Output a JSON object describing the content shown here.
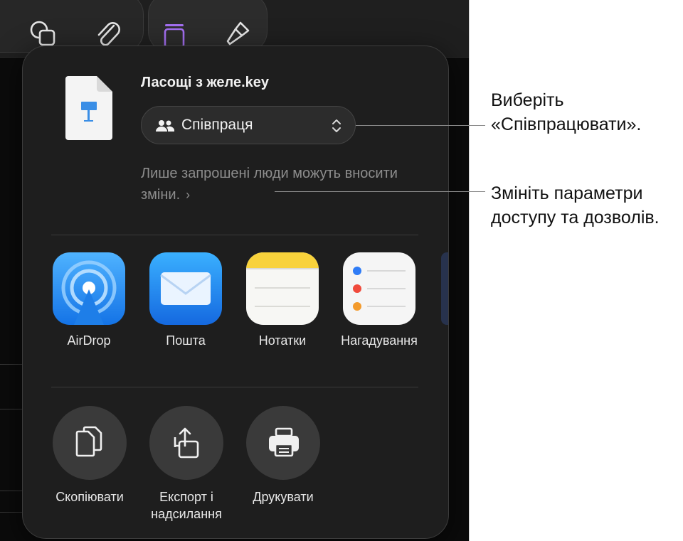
{
  "popover": {
    "document_title": "Ласощі з желе.key",
    "collaboration_mode": "Співпраця",
    "access_summary": "Лише запрошені люди можуть вносити зміни.",
    "apps": [
      {
        "label": "AirDrop",
        "icon": "airdrop-icon"
      },
      {
        "label": "Пошта",
        "icon": "mail-icon"
      },
      {
        "label": "Нотатки",
        "icon": "notes-icon"
      },
      {
        "label": "Нагадування",
        "icon": "reminders-icon"
      }
    ],
    "actions": [
      {
        "label": "Скопіювати",
        "icon": "copy-icon"
      },
      {
        "label": "Експорт і надсилання",
        "icon": "export-icon"
      },
      {
        "label": "Друкувати",
        "icon": "print-icon"
      }
    ]
  },
  "callouts": {
    "collaborate": "Виберіть «Співпрацювати».",
    "access": "Змініть параметри доступу та дозволів."
  },
  "colors": {
    "screen_bg": "#0b0b0b",
    "popover_bg": "#1e1e1e",
    "accent_purple": "#a46ff2"
  }
}
